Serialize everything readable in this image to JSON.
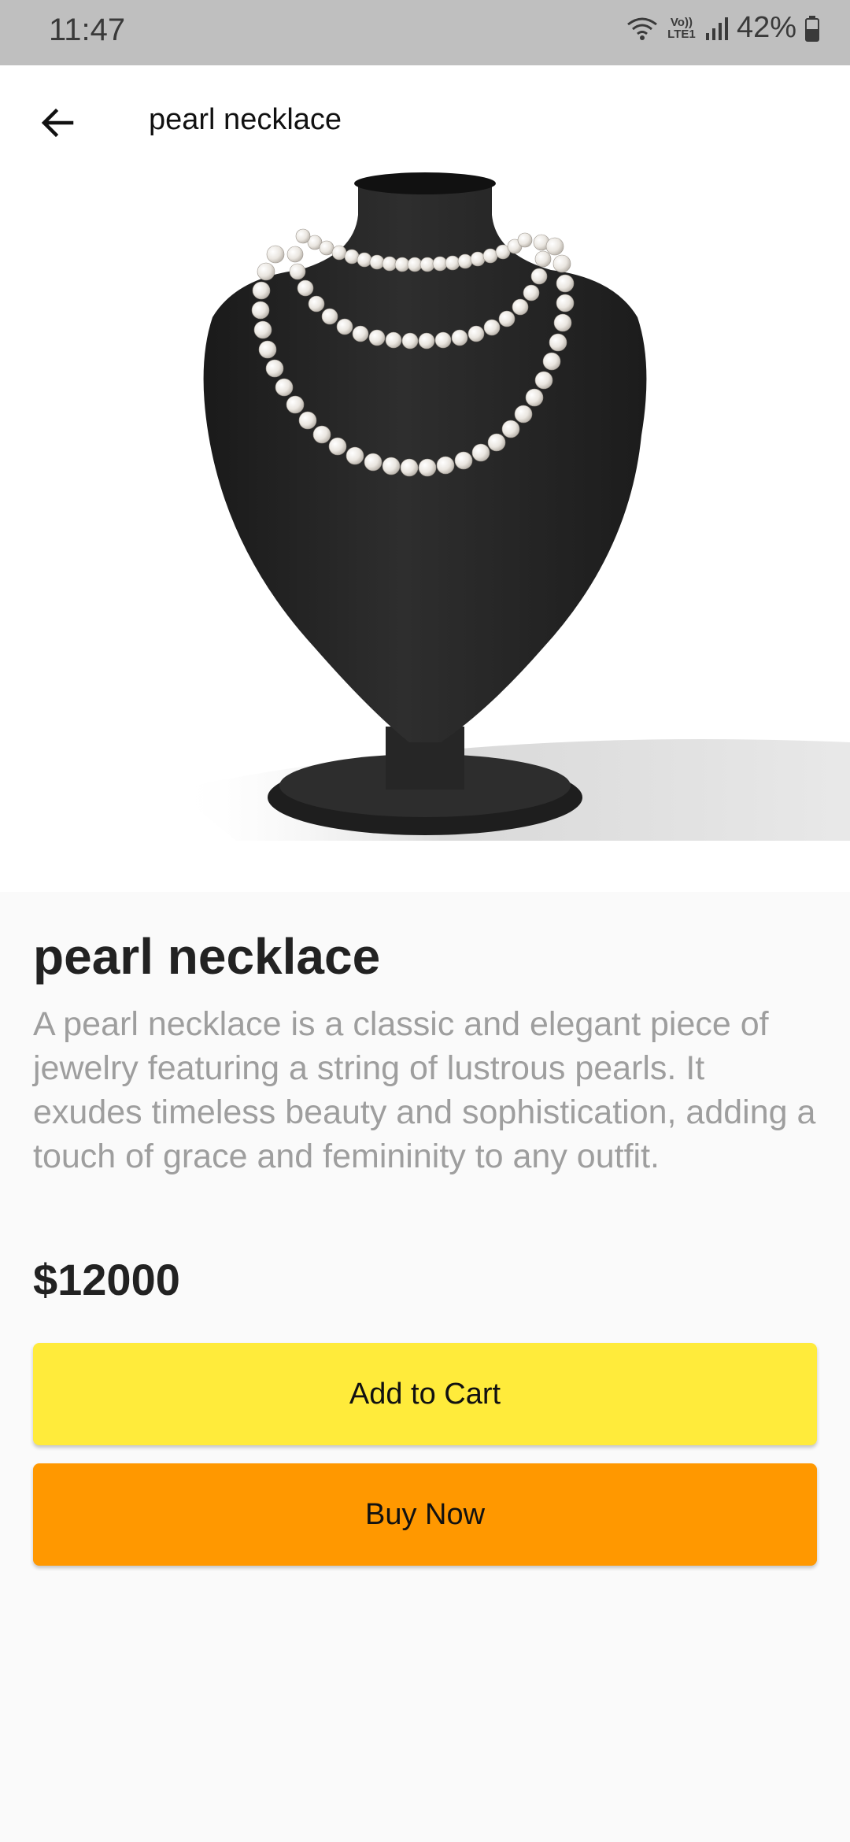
{
  "status_bar": {
    "time": "11:47",
    "network_label": "Vo)) LTE1",
    "battery": "42%",
    "icons": [
      "wifi-icon",
      "lte-icon",
      "signal-icon",
      "battery-icon"
    ]
  },
  "app_bar": {
    "back_icon": "arrow-left-icon",
    "title": "pearl necklace"
  },
  "product": {
    "image": "necklace-bust-image",
    "title": "pearl necklace",
    "description": "A pearl necklace is a classic and elegant piece of jewelry featuring a string of lustrous pearls. It exudes timeless beauty and sophistication, adding a touch of grace and femininity to any outfit.",
    "price": "$12000"
  },
  "actions": {
    "add_to_cart_label": "Add to Cart",
    "buy_now_label": "Buy Now"
  },
  "colors": {
    "add_to_cart": "#ffeb3b",
    "buy_now": "#ff9800",
    "status_bar": "#bfbfbf",
    "description_text": "#9e9e9e"
  }
}
